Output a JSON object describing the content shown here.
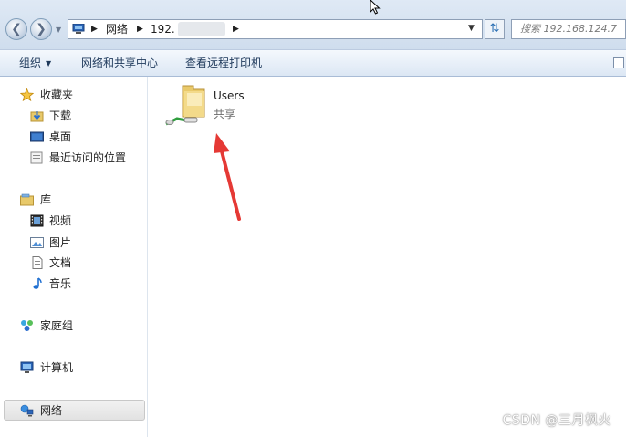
{
  "address": {
    "crumbs": [
      "网络",
      "192."
    ],
    "search_placeholder": "搜索 192.168.124.7"
  },
  "toolbar": {
    "organize": "组织",
    "network_center": "网络和共享中心",
    "remote_printers": "查看远程打印机"
  },
  "sidebar": {
    "favorites": "收藏夹",
    "downloads": "下载",
    "desktop": "桌面",
    "recent": "最近访问的位置",
    "libraries": "库",
    "videos": "视频",
    "pictures": "图片",
    "documents": "文档",
    "music": "音乐",
    "homegroup": "家庭组",
    "computer": "计算机",
    "network": "网络"
  },
  "content": {
    "items": [
      {
        "name": "Users",
        "type": "共享",
        "icon": "shared-folder-icon"
      }
    ]
  },
  "watermark": "CSDN @三月枫火",
  "colors": {
    "accent": "#1e395b",
    "annotation": "#e53935"
  }
}
